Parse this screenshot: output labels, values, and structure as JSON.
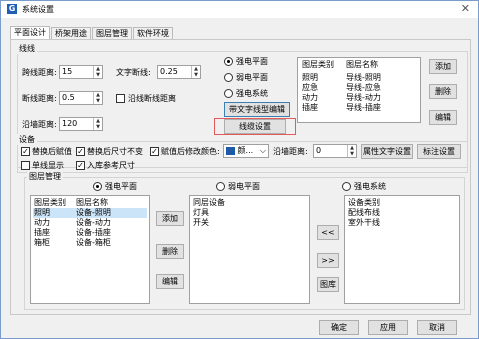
{
  "window": {
    "title": "系统设置",
    "app_icon": "G"
  },
  "tabs": [
    "平面设计",
    "桥架用途",
    "图层管理",
    "软件环境"
  ],
  "line_section": {
    "label": "线线",
    "spacing_label": "跨线距离:",
    "spacing_value": "15",
    "break_label": "文字断线:",
    "break_value": "0.25",
    "gap_label": "断线距离:",
    "gap_value": "0.5",
    "along_break_label": "沿线断线距离",
    "along_dist_label": "沿墙距离:",
    "along_dist_value": "120",
    "radios": [
      "强电平面",
      "弱电平面",
      "强电系统"
    ],
    "linetype_edit_btn": "带文字线型编辑",
    "linetype_settings_btn": "线缆设置",
    "table_headers": [
      "图层类别",
      "图层名称"
    ],
    "table_rows": [
      [
        "照明",
        "导线-照明"
      ],
      [
        "应急",
        "导线-应急"
      ],
      [
        "动力",
        "导线-动力"
      ],
      [
        "插座",
        "导线-插座"
      ]
    ],
    "add_btn": "添加",
    "delete_btn": "删除",
    "edit_btn": "编辑"
  },
  "device_section": {
    "label": "设备",
    "replace_layer": "替换后赋值",
    "keep_size": "替换后尺寸不变",
    "change_color": "赋值后修改颜色:",
    "color_value": "颜...",
    "along_wall_label": "沿墙距离:",
    "along_wall_value": "0",
    "text_settings_btn": "属性文字设置",
    "label_settings_btn": "标注设置",
    "single_display": "单线显示",
    "ref_size": "入库参考尺寸"
  },
  "layer_section": {
    "label": "图层管理",
    "radios": [
      "强电平面",
      "弱电平面",
      "强电系统"
    ],
    "left_headers": [
      "图层类别",
      "图层名称"
    ],
    "left_rows": [
      [
        "照明",
        "设备-照明"
      ],
      [
        "动力",
        "设备-动力"
      ],
      [
        "插座",
        "设备-插座"
      ],
      [
        "箱柜",
        "设备-箱柜"
      ]
    ],
    "add_btn": "添加",
    "delete_btn": "删除",
    "edit_btn": "编辑",
    "mid_header": "同层设备",
    "mid_rows": [
      "灯具",
      "开关"
    ],
    "move_left_btn": "<<",
    "move_right_btn": ">>",
    "library_btn": "图库",
    "right_header": "设备类别",
    "right_rows": [
      "配线布线",
      "室外干线"
    ]
  },
  "footer": {
    "ok": "确定",
    "apply": "应用",
    "cancel": "取消"
  },
  "colors": {
    "accent": "#1f5fb7",
    "highlight_border": "#e35a5a",
    "color_swatch": "#1e5aa8"
  }
}
